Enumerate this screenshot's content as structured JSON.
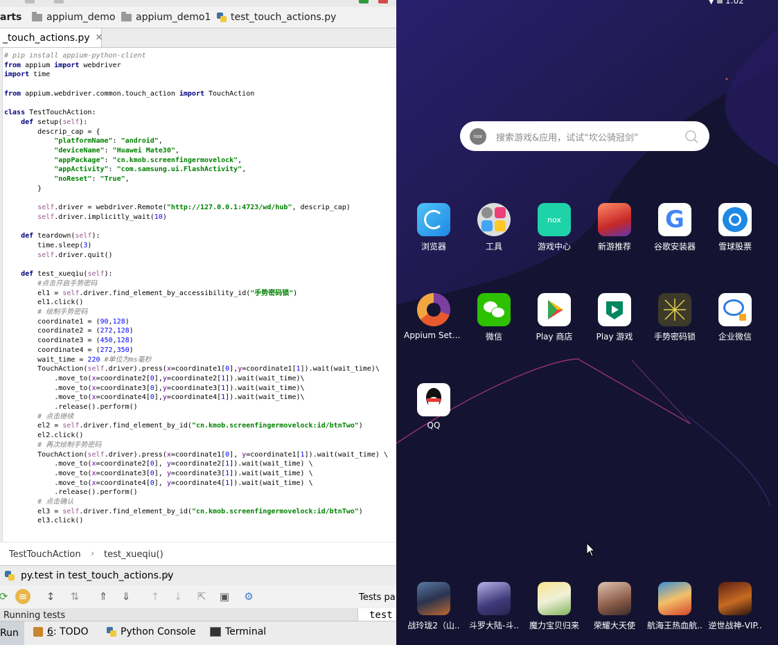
{
  "ide": {
    "breadcrumbs": [
      "arts",
      "appium_demo",
      "appium_demo1",
      "test_touch_actions.py"
    ],
    "file_tab": "_touch_actions.py",
    "close_glyph": "✕",
    "code_lines": [
      [
        {
          "c": "cmt",
          "t": "# pip install appium-python-client"
        }
      ],
      [
        {
          "c": "kw",
          "t": "from"
        },
        {
          "c": "",
          "t": " appium "
        },
        {
          "c": "kw",
          "t": "import"
        },
        {
          "c": "",
          "t": " webdriver"
        }
      ],
      [
        {
          "c": "kw",
          "t": "import"
        },
        {
          "c": "",
          "t": " time"
        }
      ],
      [],
      [
        {
          "c": "kw",
          "t": "from"
        },
        {
          "c": "",
          "t": " appium.webdriver.common.touch_action "
        },
        {
          "c": "kw",
          "t": "import"
        },
        {
          "c": "",
          "t": " TouchAction"
        }
      ],
      [],
      [
        {
          "c": "kw",
          "t": "class"
        },
        {
          "c": "",
          "t": " TestTouchAction:"
        }
      ],
      [
        {
          "c": "",
          "t": "    "
        },
        {
          "c": "kw",
          "t": "def"
        },
        {
          "c": "",
          "t": " setup("
        },
        {
          "c": "slf",
          "t": "self"
        },
        {
          "c": "",
          "t": "):"
        }
      ],
      [
        {
          "c": "",
          "t": "        descrip_cap = {"
        }
      ],
      [
        {
          "c": "",
          "t": "            "
        },
        {
          "c": "str",
          "t": "\"platformName\""
        },
        {
          "c": "",
          "t": ": "
        },
        {
          "c": "str",
          "t": "\"android\""
        },
        {
          "c": "",
          "t": ","
        }
      ],
      [
        {
          "c": "",
          "t": "            "
        },
        {
          "c": "str",
          "t": "\"deviceName\""
        },
        {
          "c": "",
          "t": ": "
        },
        {
          "c": "str",
          "t": "\"Huawei Mate30\""
        },
        {
          "c": "",
          "t": ","
        }
      ],
      [
        {
          "c": "",
          "t": "            "
        },
        {
          "c": "str",
          "t": "\"appPackage\""
        },
        {
          "c": "",
          "t": ": "
        },
        {
          "c": "str",
          "t": "\"cn.kmob.screenfingermovelock\""
        },
        {
          "c": "",
          "t": ","
        }
      ],
      [
        {
          "c": "",
          "t": "            "
        },
        {
          "c": "str",
          "t": "\"appActivity\""
        },
        {
          "c": "",
          "t": ": "
        },
        {
          "c": "str",
          "t": "\"com.samsung.ui.FlashActivity\""
        },
        {
          "c": "",
          "t": ","
        }
      ],
      [
        {
          "c": "",
          "t": "            "
        },
        {
          "c": "str",
          "t": "\"noReset\""
        },
        {
          "c": "",
          "t": ": "
        },
        {
          "c": "str",
          "t": "\"True\""
        },
        {
          "c": "",
          "t": ","
        }
      ],
      [
        {
          "c": "",
          "t": "        }"
        }
      ],
      [],
      [
        {
          "c": "",
          "t": "        "
        },
        {
          "c": "slf",
          "t": "self"
        },
        {
          "c": "",
          "t": ".driver = webdriver.Remote("
        },
        {
          "c": "str",
          "t": "\"http://127.0.0.1:4723/wd/hub\""
        },
        {
          "c": "",
          "t": ", descrip_cap)"
        }
      ],
      [
        {
          "c": "",
          "t": "        "
        },
        {
          "c": "slf",
          "t": "self"
        },
        {
          "c": "",
          "t": ".driver.implicitly_wait("
        },
        {
          "c": "num",
          "t": "10"
        },
        {
          "c": "",
          "t": ")"
        }
      ],
      [],
      [
        {
          "c": "",
          "t": "    "
        },
        {
          "c": "kw",
          "t": "def"
        },
        {
          "c": "",
          "t": " teardown("
        },
        {
          "c": "slf",
          "t": "self"
        },
        {
          "c": "",
          "t": "):"
        }
      ],
      [
        {
          "c": "",
          "t": "        time.sleep("
        },
        {
          "c": "num",
          "t": "3"
        },
        {
          "c": "",
          "t": ")"
        }
      ],
      [
        {
          "c": "",
          "t": "        "
        },
        {
          "c": "slf",
          "t": "self"
        },
        {
          "c": "",
          "t": ".driver.quit()"
        }
      ],
      [],
      [
        {
          "c": "",
          "t": "    "
        },
        {
          "c": "kw",
          "t": "def"
        },
        {
          "c": "",
          "t": " test_xueqiu("
        },
        {
          "c": "slf",
          "t": "self"
        },
        {
          "c": "",
          "t": "):"
        }
      ],
      [
        {
          "c": "",
          "t": "        "
        },
        {
          "c": "cmt",
          "t": "#点击开启手势密码"
        }
      ],
      [
        {
          "c": "",
          "t": "        el1 = "
        },
        {
          "c": "slf",
          "t": "self"
        },
        {
          "c": "",
          "t": ".driver.find_element_by_accessibility_id("
        },
        {
          "c": "str",
          "t": "\"手势密码锁\""
        },
        {
          "c": "",
          "t": ")"
        }
      ],
      [
        {
          "c": "",
          "t": "        el1.click()"
        }
      ],
      [
        {
          "c": "",
          "t": "        "
        },
        {
          "c": "cmt",
          "t": "# 绘制手势密码"
        }
      ],
      [
        {
          "c": "",
          "t": "        coordinate1 = ("
        },
        {
          "c": "num",
          "t": "90"
        },
        {
          "c": "",
          "t": ","
        },
        {
          "c": "num",
          "t": "128"
        },
        {
          "c": "",
          "t": ")"
        }
      ],
      [
        {
          "c": "",
          "t": "        coordinate2 = ("
        },
        {
          "c": "num",
          "t": "272"
        },
        {
          "c": "",
          "t": ","
        },
        {
          "c": "num",
          "t": "128"
        },
        {
          "c": "",
          "t": ")"
        }
      ],
      [
        {
          "c": "",
          "t": "        coordinate3 = ("
        },
        {
          "c": "num",
          "t": "450"
        },
        {
          "c": "",
          "t": ","
        },
        {
          "c": "num",
          "t": "128"
        },
        {
          "c": "",
          "t": ")"
        }
      ],
      [
        {
          "c": "",
          "t": "        coordinate4 = ("
        },
        {
          "c": "num",
          "t": "272"
        },
        {
          "c": "",
          "t": ","
        },
        {
          "c": "num",
          "t": "350"
        },
        {
          "c": "",
          "t": ")"
        }
      ],
      [
        {
          "c": "",
          "t": "        wait_time = "
        },
        {
          "c": "num",
          "t": "220"
        },
        {
          "c": "",
          "t": " "
        },
        {
          "c": "cmt",
          "t": "#单位为ms毫秒"
        }
      ],
      [
        {
          "c": "",
          "t": "        TouchAction("
        },
        {
          "c": "slf",
          "t": "self"
        },
        {
          "c": "",
          "t": ".driver).press("
        },
        {
          "c": "kwa",
          "t": "x"
        },
        {
          "c": "",
          "t": "=coordinate1["
        },
        {
          "c": "num",
          "t": "0"
        },
        {
          "c": "",
          "t": "],"
        },
        {
          "c": "kwa",
          "t": "y"
        },
        {
          "c": "",
          "t": "=coordinate1["
        },
        {
          "c": "num",
          "t": "1"
        },
        {
          "c": "",
          "t": "]).wait(wait_time)\\"
        }
      ],
      [
        {
          "c": "",
          "t": "            .move_to("
        },
        {
          "c": "kwa",
          "t": "x"
        },
        {
          "c": "",
          "t": "=coordinate2["
        },
        {
          "c": "num",
          "t": "0"
        },
        {
          "c": "",
          "t": "],"
        },
        {
          "c": "kwa",
          "t": "y"
        },
        {
          "c": "",
          "t": "=coordinate2["
        },
        {
          "c": "num",
          "t": "1"
        },
        {
          "c": "",
          "t": "]).wait(wait_time)\\"
        }
      ],
      [
        {
          "c": "",
          "t": "            .move_to("
        },
        {
          "c": "kwa",
          "t": "x"
        },
        {
          "c": "",
          "t": "=coordinate3["
        },
        {
          "c": "num",
          "t": "0"
        },
        {
          "c": "",
          "t": "],"
        },
        {
          "c": "kwa",
          "t": "y"
        },
        {
          "c": "",
          "t": "=coordinate3["
        },
        {
          "c": "num",
          "t": "1"
        },
        {
          "c": "",
          "t": "]).wait(wait_time)\\"
        }
      ],
      [
        {
          "c": "",
          "t": "            .move_to("
        },
        {
          "c": "kwa",
          "t": "x"
        },
        {
          "c": "",
          "t": "=coordinate4["
        },
        {
          "c": "num",
          "t": "0"
        },
        {
          "c": "",
          "t": "],"
        },
        {
          "c": "kwa",
          "t": "y"
        },
        {
          "c": "",
          "t": "=coordinate4["
        },
        {
          "c": "num",
          "t": "1"
        },
        {
          "c": "",
          "t": "]).wait(wait_time)\\"
        }
      ],
      [
        {
          "c": "",
          "t": "            .release().perform()"
        }
      ],
      [
        {
          "c": "",
          "t": "        "
        },
        {
          "c": "cmt",
          "t": "# 点击继续"
        }
      ],
      [
        {
          "c": "",
          "t": "        el2 = "
        },
        {
          "c": "slf",
          "t": "self"
        },
        {
          "c": "",
          "t": ".driver.find_element_by_id("
        },
        {
          "c": "str",
          "t": "\"cn.kmob.screenfingermovelock:id/btnTwo\""
        },
        {
          "c": "",
          "t": ")"
        }
      ],
      [
        {
          "c": "",
          "t": "        el2.click()"
        }
      ],
      [
        {
          "c": "",
          "t": "        "
        },
        {
          "c": "cmt",
          "t": "# 再次绘制手势密码"
        }
      ],
      [
        {
          "c": "",
          "t": "        TouchAction("
        },
        {
          "c": "slf",
          "t": "self"
        },
        {
          "c": "",
          "t": ".driver).press("
        },
        {
          "c": "kwa",
          "t": "x"
        },
        {
          "c": "",
          "t": "=coordinate1["
        },
        {
          "c": "num",
          "t": "0"
        },
        {
          "c": "",
          "t": "], "
        },
        {
          "c": "kwa",
          "t": "y"
        },
        {
          "c": "",
          "t": "=coordinate1["
        },
        {
          "c": "num",
          "t": "1"
        },
        {
          "c": "",
          "t": "]).wait(wait_time) \\"
        }
      ],
      [
        {
          "c": "",
          "t": "            .move_to("
        },
        {
          "c": "kwa",
          "t": "x"
        },
        {
          "c": "",
          "t": "=coordinate2["
        },
        {
          "c": "num",
          "t": "0"
        },
        {
          "c": "",
          "t": "], "
        },
        {
          "c": "kwa",
          "t": "y"
        },
        {
          "c": "",
          "t": "=coordinate2["
        },
        {
          "c": "num",
          "t": "1"
        },
        {
          "c": "",
          "t": "]).wait(wait_time) \\"
        }
      ],
      [
        {
          "c": "",
          "t": "            .move_to("
        },
        {
          "c": "kwa",
          "t": "x"
        },
        {
          "c": "",
          "t": "=coordinate3["
        },
        {
          "c": "num",
          "t": "0"
        },
        {
          "c": "",
          "t": "], "
        },
        {
          "c": "kwa",
          "t": "y"
        },
        {
          "c": "",
          "t": "=coordinate3["
        },
        {
          "c": "num",
          "t": "1"
        },
        {
          "c": "",
          "t": "]).wait(wait_time) \\"
        }
      ],
      [
        {
          "c": "",
          "t": "            .move_to("
        },
        {
          "c": "kwa",
          "t": "x"
        },
        {
          "c": "",
          "t": "=coordinate4["
        },
        {
          "c": "num",
          "t": "0"
        },
        {
          "c": "",
          "t": "], "
        },
        {
          "c": "kwa",
          "t": "y"
        },
        {
          "c": "",
          "t": "=coordinate4["
        },
        {
          "c": "num",
          "t": "1"
        },
        {
          "c": "",
          "t": "]).wait(wait_time) \\"
        }
      ],
      [
        {
          "c": "",
          "t": "            .release().perform()"
        }
      ],
      [
        {
          "c": "",
          "t": "        "
        },
        {
          "c": "cmt",
          "t": "# 点击确认"
        }
      ],
      [
        {
          "c": "",
          "t": "        el3 = "
        },
        {
          "c": "slf",
          "t": "self"
        },
        {
          "c": "",
          "t": ".driver.find_element_by_id("
        },
        {
          "c": "str",
          "t": "\"cn.kmob.screenfingermovelock:id/btnTwo\""
        },
        {
          "c": "",
          "t": ")"
        }
      ],
      [
        {
          "c": "",
          "t": "        el3.click()"
        }
      ]
    ],
    "editor_breadcrumb": {
      "class_name": "TestTouchAction",
      "separator": "›",
      "method_name": "test_xueqiu()"
    },
    "run_tab": {
      "label": "py.test in test_touch_actions.py"
    },
    "run_side": {
      "tests_label": "Tests pa",
      "test_item": "test"
    },
    "running_text": "Running tests",
    "bottom": {
      "run": "Run",
      "todo_num": "6",
      "todo_label": ": TODO",
      "python_console": "Python Console",
      "terminal": "Terminal"
    }
  },
  "phone": {
    "status_time": "1:02",
    "search": {
      "logo": "nox",
      "placeholder": "搜索游戏&应用，试试“坎公骑冠剑”"
    },
    "apps": {
      "browser": "浏览器",
      "tools": "工具",
      "game_center": "游戏中心",
      "new_games": "新游推荐",
      "google_installer": "谷歌安装器",
      "xueqiu": "雪球股票",
      "appium": "Appium Settin..",
      "wechat": "微信",
      "play_store": "Play 商店",
      "play_games": "Play 游戏",
      "gesture_lock": "手势密码锁",
      "wecom": "企业微信",
      "qq": "QQ",
      "dock1": "战玲珑2（山..",
      "dock2": "斗罗大陆-斗..",
      "dock3": "魔力宝贝归来",
      "dock4": "荣耀大天使",
      "dock5": "航海王热血航..",
      "dock6": "逆世战神-VIP.."
    },
    "nox_label": "nox"
  },
  "colors": {
    "phone_bg": "#141432",
    "editor_bg": "#ffffff",
    "keyword": "#000080",
    "string": "#008000",
    "number": "#0000ff",
    "comment": "#808080",
    "self": "#94558d"
  }
}
